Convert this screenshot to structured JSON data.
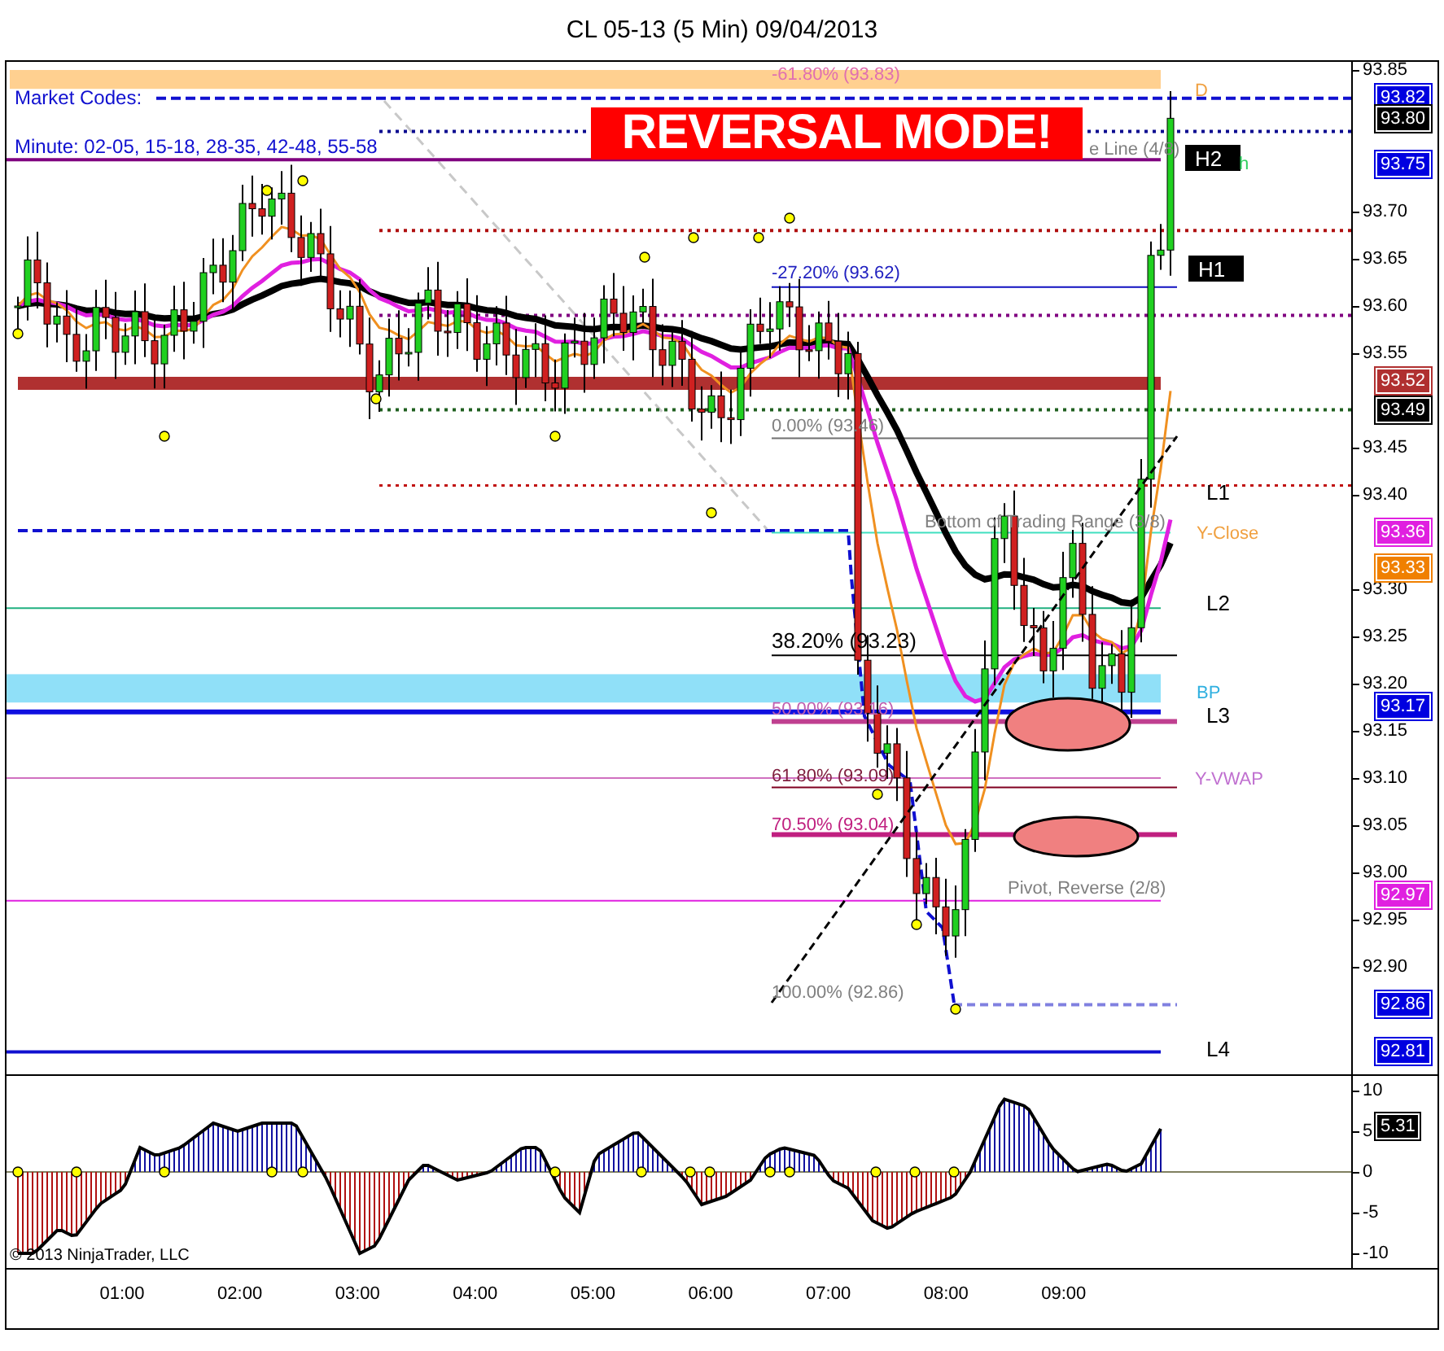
{
  "title": "CL 05-13 (5 Min)  09/04/2013",
  "banner": "REVERSAL MODE!",
  "market_codes": "Market Codes:",
  "minute_codes": "Minute: 02-05, 15-18, 28-35, 42-48, 55-58",
  "plot_labels": [
    {
      "kind": "text",
      "text": "-61.80% (93.83)"
    },
    {
      "kind": "text",
      "text": "D"
    },
    {
      "kind": "text",
      "text": "e Line (4/8)"
    },
    {
      "kind": "tag",
      "text": "H2"
    },
    {
      "kind": "text",
      "text": "h"
    },
    {
      "kind": "text",
      "text": "-27.20% (93.62)"
    },
    {
      "kind": "tag",
      "text": "H1"
    },
    {
      "kind": "text",
      "text": "0.00% (93.46)"
    },
    {
      "kind": "text",
      "text": "L1"
    },
    {
      "kind": "text",
      "text": "Bottom of Trading Range (3/8)"
    },
    {
      "kind": "text",
      "text": "Y-Close"
    },
    {
      "kind": "text",
      "text": "L2"
    },
    {
      "kind": "text",
      "text": "38.20% (93.23)"
    },
    {
      "kind": "text",
      "text": "BP"
    },
    {
      "kind": "text",
      "text": "50.00% (93.16)"
    },
    {
      "kind": "text",
      "text": "L3"
    },
    {
      "kind": "text",
      "text": "61.80% (93.09)"
    },
    {
      "kind": "text",
      "text": "Y-VWAP"
    },
    {
      "kind": "text",
      "text": "70.50% (93.04)"
    },
    {
      "kind": "text",
      "text": "Pivot, Reverse (2/8)"
    },
    {
      "kind": "text",
      "text": "100.00% (92.86)"
    },
    {
      "kind": "text",
      "text": "L4"
    }
  ],
  "price_axis": {
    "ticks": [
      "93.85",
      "93.70",
      "93.65",
      "93.60",
      "93.55",
      "93.45",
      "93.40",
      "93.30",
      "93.25",
      "93.20",
      "93.15",
      "93.10",
      "93.05",
      "93.00",
      "92.95",
      "92.90"
    ],
    "tags": [
      {
        "text": "93.82",
        "color": "#0000e0"
      },
      {
        "text": "93.80",
        "color": "#000000"
      },
      {
        "text": "93.75",
        "color": "#0000e0"
      },
      {
        "text": "93.52",
        "color": "#b03030"
      },
      {
        "text": "93.49",
        "color": "#000000"
      },
      {
        "text": "93.36",
        "color": "#e020e0"
      },
      {
        "text": "93.33",
        "color": "#f08000"
      },
      {
        "text": "93.17",
        "color": "#0000e0"
      },
      {
        "text": "92.97",
        "color": "#e020e0"
      },
      {
        "text": "92.86",
        "color": "#0000e0"
      },
      {
        "text": "92.81",
        "color": "#0000e0"
      }
    ]
  },
  "oscillator": {
    "ticks": [
      "10",
      "5",
      "0",
      "-5",
      "-10"
    ],
    "tag": "5.31"
  },
  "copyright": "© 2013 NinjaTrader, LLC",
  "time_axis": [
    "01:00",
    "02:00",
    "03:00",
    "04:00",
    "05:00",
    "06:00",
    "07:00",
    "08:00",
    "09:00"
  ]
}
